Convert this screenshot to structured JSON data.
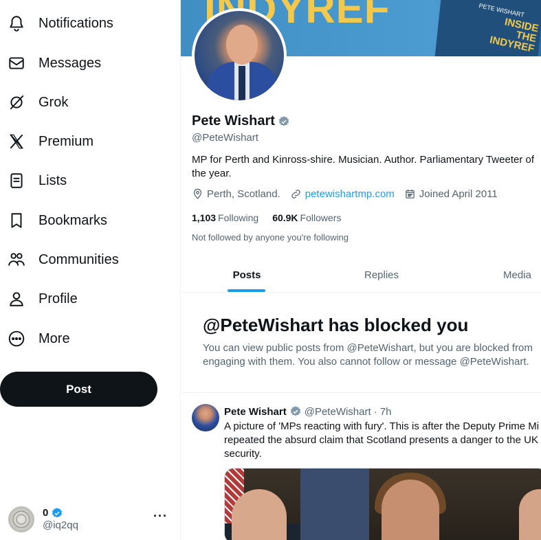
{
  "sidebar": {
    "items": [
      {
        "label": "Notifications",
        "icon": "bell-icon"
      },
      {
        "label": "Messages",
        "icon": "envelope-icon"
      },
      {
        "label": "Grok",
        "icon": "grok-icon"
      },
      {
        "label": "Premium",
        "icon": "x-logo-icon"
      },
      {
        "label": "Lists",
        "icon": "list-icon"
      },
      {
        "label": "Bookmarks",
        "icon": "bookmark-icon"
      },
      {
        "label": "Communities",
        "icon": "communities-icon"
      },
      {
        "label": "Profile",
        "icon": "person-icon"
      },
      {
        "label": "More",
        "icon": "more-circle-icon"
      }
    ],
    "post_button": "Post",
    "account": {
      "display_name": "0",
      "handle": "@iq2qq",
      "more": "···"
    }
  },
  "profile": {
    "banner_text": "INDYREF",
    "banner_book_title": "INSIDE THE INDYREF",
    "banner_book_author": "PETE WISHART",
    "name": "Pete Wishart",
    "handle": "@PeteWishart",
    "bio": "MP for Perth and Kinross-shire. Musician. Author. Parliamentary Tweeter of the year.",
    "location": "Perth, Scotland.",
    "website": "petewishartmp.com",
    "joined": "Joined April 2011",
    "following_count": "1,103",
    "following_label": "Following",
    "followers_count": "60.9K",
    "followers_label": "Followers",
    "not_followed": "Not followed by anyone you're following"
  },
  "tabs": [
    {
      "label": "Posts",
      "active": true
    },
    {
      "label": "Replies",
      "active": false
    },
    {
      "label": "Media",
      "active": false
    }
  ],
  "blocked": {
    "title": "@PeteWishart has blocked you",
    "description": "You can view public posts from @PeteWishart, but you are blocked from engaging with them. You also cannot follow or message @PeteWishart."
  },
  "tweet": {
    "name": "Pete Wishart",
    "handle": "@PeteWishart",
    "time": "· 7h",
    "line1": "A picture of 'MPs reacting with fury'. This is after the Deputy Prime Mi",
    "line2": "repeated the absurd claim that Scotland presents a danger to the UK",
    "line3": "security."
  },
  "colors": {
    "accent": "#1d9bf0",
    "text_primary": "#0f1419",
    "text_secondary": "#536471",
    "verified": "#829aab",
    "post_button_bg": "#0f1419"
  }
}
